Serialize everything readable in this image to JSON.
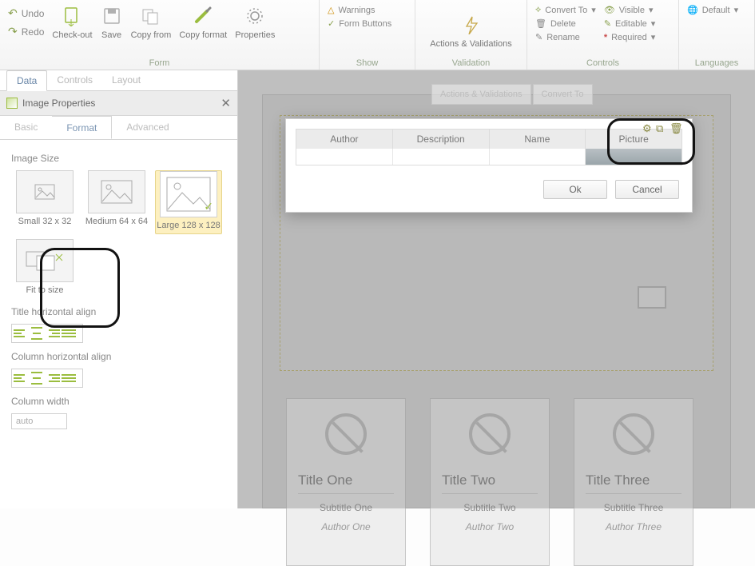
{
  "ribbon": {
    "undo": "Undo",
    "redo": "Redo",
    "checkout": "Check-out",
    "save": "Save",
    "copyfrom": "Copy from",
    "copyformat": "Copy format",
    "properties": "Properties",
    "form_group": "Form",
    "warnings": "Warnings",
    "formbuttons": "Form Buttons",
    "show_group": "Show",
    "actionsvalid": "Actions & Validations",
    "validation_group": "Validation",
    "convertto": "Convert To",
    "delete": "Delete",
    "rename": "Rename",
    "visible": "Visible",
    "editable": "Editable",
    "required": "Required",
    "controls_group": "Controls",
    "default": "Default",
    "languages_group": "Languages"
  },
  "panel": {
    "tabs": {
      "data": "Data",
      "controls": "Controls",
      "layout": "Layout"
    },
    "title": "Image Properties",
    "subtabs": {
      "basic": "Basic",
      "format": "Format",
      "advanced": "Advanced"
    },
    "image_size": "Image Size",
    "sizes": {
      "small": "Small   32 x 32",
      "medium": "Medium  64 x 64",
      "large": "Large 128 x 128",
      "fit": "Fit to size"
    },
    "title_halign": "Title horizontal align",
    "col_halign": "Column horizontal align",
    "col_width": "Column width",
    "col_width_value": "auto"
  },
  "ghost_tabs": {
    "av": "Actions & Validations",
    "ct": "Convert To"
  },
  "dialog": {
    "cols": {
      "author": "Author",
      "desc": "Description",
      "name": "Name",
      "picture": "Picture"
    },
    "ok": "Ok",
    "cancel": "Cancel"
  },
  "cards": [
    {
      "title": "Title One",
      "subtitle": "Subtitle One",
      "author": "Author One"
    },
    {
      "title": "Title Two",
      "subtitle": "Subtitle Two",
      "author": "Author Two"
    },
    {
      "title": "Title Three",
      "subtitle": "Subtitle Three",
      "author": "Author Three"
    }
  ]
}
